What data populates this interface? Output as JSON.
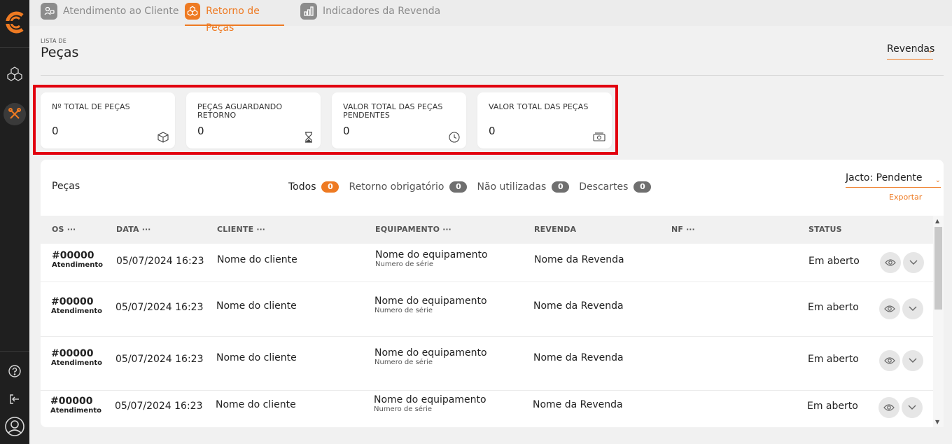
{
  "sidebar": {
    "logo": "company-logo",
    "items": [
      {
        "icon": "cubes-icon"
      },
      {
        "icon": "tools-icon",
        "active": true
      }
    ],
    "bottom": [
      {
        "icon": "help-icon"
      },
      {
        "icon": "logout-icon"
      },
      {
        "icon": "user-avatar-icon"
      }
    ]
  },
  "tabs": [
    {
      "label": "Atendimento ao Cliente",
      "icon": "support-icon"
    },
    {
      "label": "Retorno de Peças",
      "icon": "parts-icon",
      "active": true
    },
    {
      "label": "Indicadores da Revenda",
      "icon": "bar-chart-icon"
    }
  ],
  "header": {
    "pre_title": "LISTA DE",
    "title": "Peças",
    "revendas_label": "Revendas"
  },
  "stats": [
    {
      "label": "Nº TOTAL DE PEÇAS",
      "value": "0",
      "icon": "box-icon"
    },
    {
      "label": "PEÇAS AGUARDANDO RETORNO",
      "value": "0",
      "icon": "hourglass-icon"
    },
    {
      "label": "VALOR TOTAL DAS PEÇAS PENDENTES",
      "value": "0",
      "icon": "clock-icon"
    },
    {
      "label": "VALOR TOTAL DAS PEÇAS",
      "value": "0",
      "icon": "money-icon"
    }
  ],
  "panel": {
    "title": "Peças",
    "filters": [
      {
        "label": "Todos",
        "count": "0",
        "active": true
      },
      {
        "label": "Retorno obrigatório",
        "count": "0"
      },
      {
        "label": "Não utilizadas",
        "count": "0"
      },
      {
        "label": "Descartes",
        "count": "0"
      }
    ],
    "status_select": "Jacto: Pendente",
    "export_label": "Exportar",
    "columns": [
      {
        "label": "OS",
        "dots": "···"
      },
      {
        "label": "DATA",
        "dots": "···"
      },
      {
        "label": "CLIENTE",
        "dots": "···"
      },
      {
        "label": "EQUIPAMENTO",
        "dots": "···"
      },
      {
        "label": "REVENDA",
        "dots": ""
      },
      {
        "label": "NF",
        "dots": "···"
      },
      {
        "label": "STATUS",
        "dots": ""
      }
    ],
    "rows": [
      {
        "os": "#00000",
        "os_type": "Atendimento",
        "data": "05/07/2024 16:23",
        "cliente": "Nome do cliente",
        "equipamento": "Nome do equipamento",
        "serie": "Numero de série",
        "revenda": "Nome da Revenda",
        "nf": "",
        "status": "Em aberto"
      },
      {
        "os": "#00000",
        "os_type": "Atendimento",
        "data": "05/07/2024 16:23",
        "cliente": "Nome do cliente",
        "equipamento": "Nome do equipamento",
        "serie": "Numero de série",
        "revenda": "Nome da Revenda",
        "nf": "",
        "status": "Em aberto"
      },
      {
        "os": "#00000",
        "os_type": "Atendimento",
        "data": "05/07/2024 16:23",
        "cliente": "Nome do cliente",
        "equipamento": "Nome do equipamento",
        "serie": "Numero de série",
        "revenda": "Nome da Revenda",
        "nf": "",
        "status": "Em aberto"
      },
      {
        "os": "#00000",
        "os_type": "Atendimento",
        "data": "05/07/2024 16:23",
        "cliente": "Nome do cliente",
        "equipamento": "Nome do equipamento",
        "serie": "Numero de série",
        "revenda": "Nome da Revenda",
        "nf": "",
        "status": "Em aberto"
      }
    ]
  },
  "colors": {
    "accent": "#ee7a22",
    "sidebar_bg": "#1f1f1f",
    "highlight_frame": "#e2000f"
  }
}
